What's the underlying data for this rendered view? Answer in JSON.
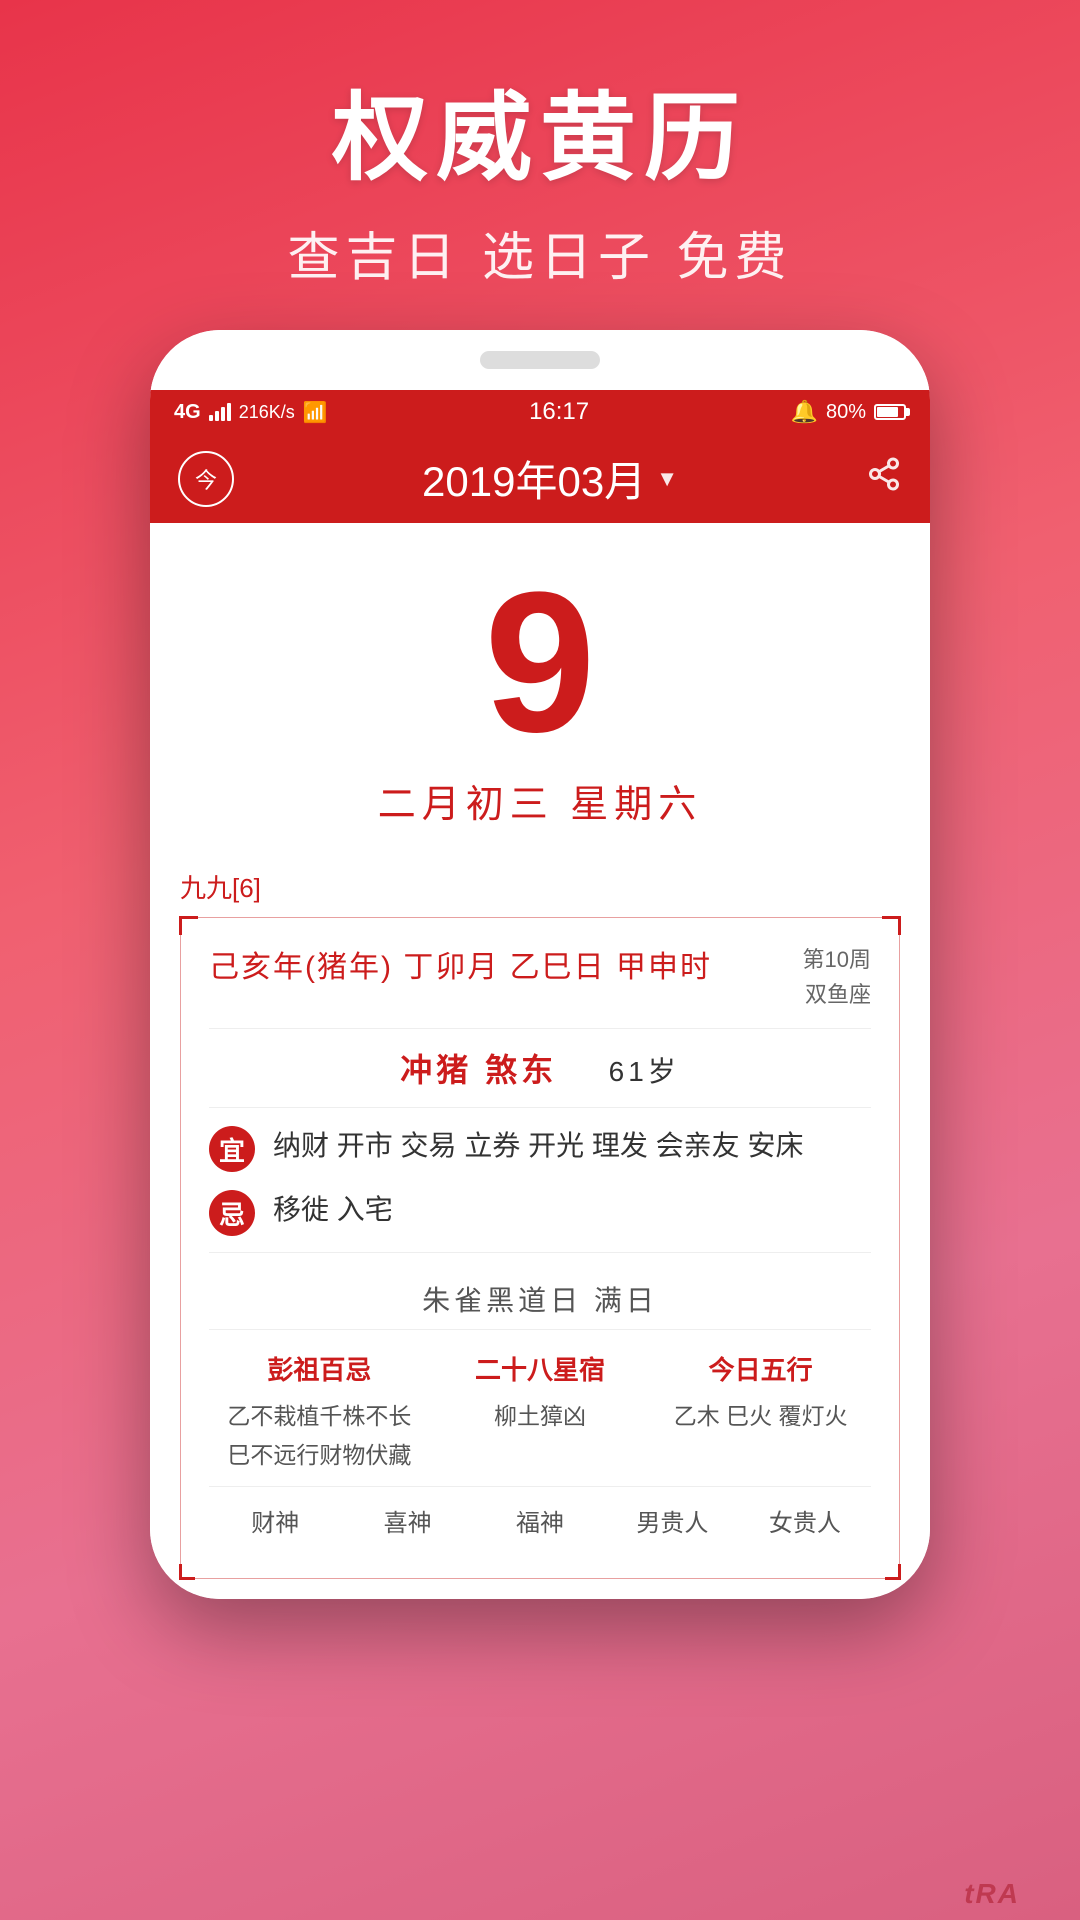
{
  "app": {
    "main_title": "权威黄历",
    "sub_title": "查吉日 选日子 免费"
  },
  "status_bar": {
    "signal_label": "4G",
    "speed": "216K/s",
    "wifi": "WiFi",
    "time": "16:17",
    "battery_pct": "80%"
  },
  "header": {
    "today_label": "今",
    "month_display": "2019年03月",
    "dropdown_arrow": "▼",
    "share_icon": "share"
  },
  "date_display": {
    "day_number": "9",
    "lunar_date": "二月初三  星期六"
  },
  "almanac": {
    "nine_nine": "九九[6]",
    "ganzhi": "己亥年(猪年) 丁卯月  乙巳日  甲申时",
    "week_label": "第10周",
    "zodiac": "双鱼座",
    "clash": "冲猪  煞东",
    "clash_age": "61岁",
    "yi_label": "宜",
    "yi_content": "纳财 开市 交易 立券 开光 理发 会亲友 安床",
    "ji_label": "忌",
    "ji_content": "移徙 入宅",
    "black_day": "朱雀黑道日  满日",
    "col1_title": "彭祖百忌",
    "col1_line1": "乙不栽植千株不长",
    "col1_line2": "巳不远行财物伏藏",
    "col2_title": "二十八星宿",
    "col2_content": "柳土獐凶",
    "col3_title": "今日五行",
    "col3_content": "乙木 巳火 覆灯火",
    "footer_labels": [
      "财神",
      "喜神",
      "福神",
      "男贵人",
      "女贵人"
    ]
  },
  "bottom_label": "tRA"
}
